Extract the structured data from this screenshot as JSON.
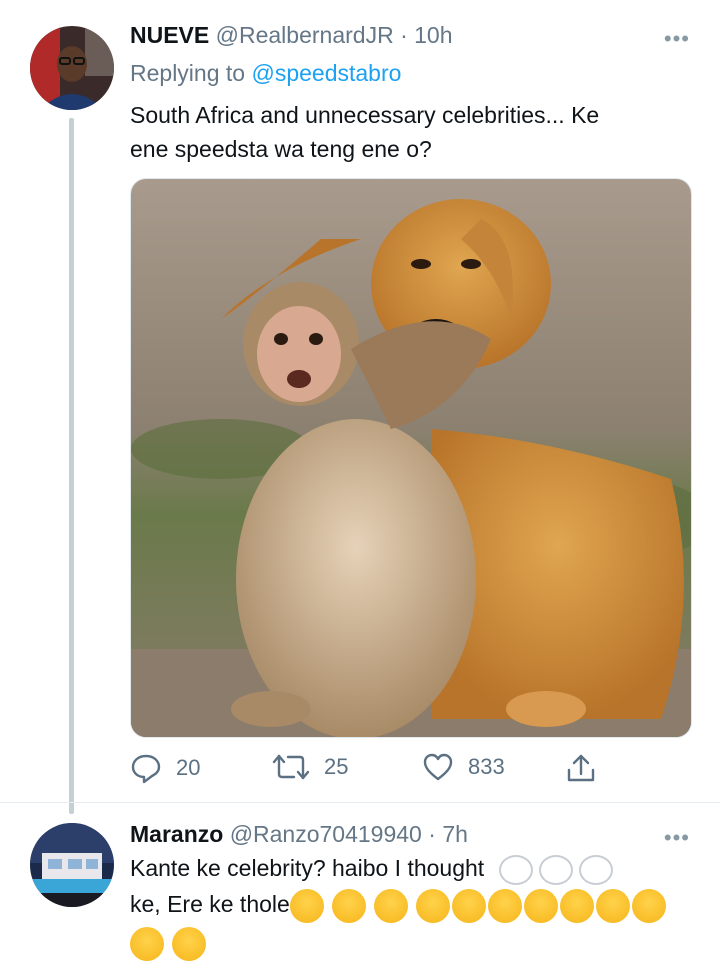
{
  "tweet1": {
    "name": "NUEVE",
    "handle": "@RealbernardJR",
    "sep": "·",
    "time": "10h",
    "replying_prefix": "Replying to ",
    "replying_handle": "@speedstabro",
    "text_line1": "South Africa and unnecessary celebrities... Ke",
    "text_line2": "ene speedsta wa teng ene o?",
    "media_icon": "photo-dog-and-monkey",
    "counts": {
      "replies": "20",
      "retweets": "25",
      "likes": "833"
    }
  },
  "tweet2": {
    "name": "Maranzo",
    "handle": "@Ranzo70419940",
    "sep": "·",
    "time": "7h",
    "text_line1": "Kante ke celebrity? haibo I thought",
    "text_line2": "ke, Ere ke  thole",
    "emojis_line1": [
      "thought-bubble",
      "thought-bubble",
      "thought-bubble"
    ],
    "emojis_line2": [
      "crying-face",
      "crying-face",
      "crying-face",
      "laughing-face",
      "laughing-face",
      "laughing-face",
      "laughing-face",
      "laughing-face",
      "laughing-face",
      "laughing-face"
    ],
    "emojis_line3": [
      "heart-eyes-face",
      "heart-eyes-face"
    ]
  },
  "colors": {
    "link": "#1da1f2",
    "muted": "#657786",
    "thread": "#c4cfd6"
  },
  "more_label": "•••"
}
